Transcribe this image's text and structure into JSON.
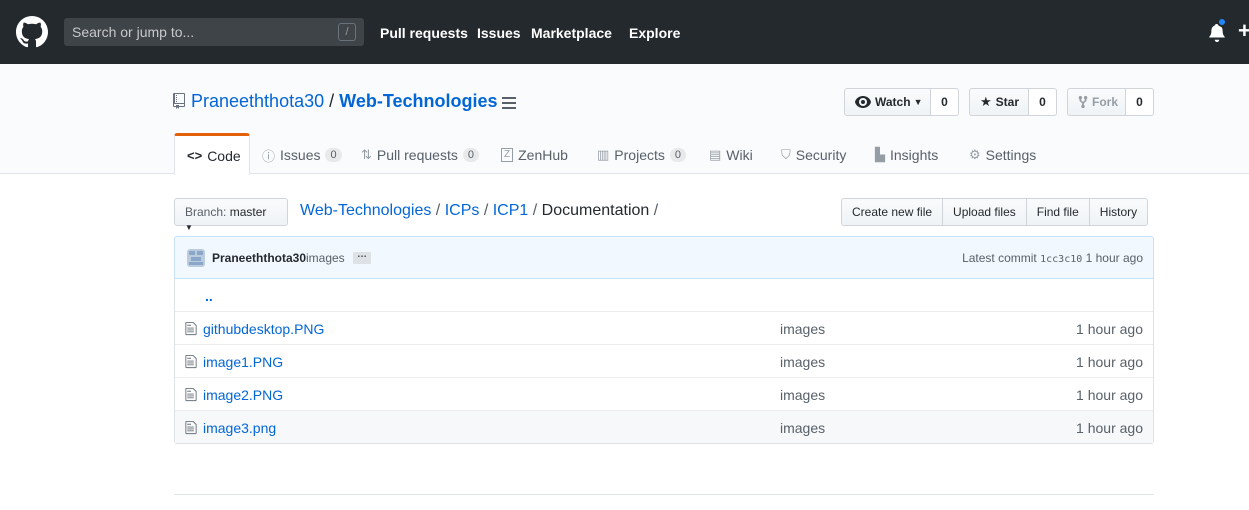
{
  "header": {
    "search_placeholder": "Search or jump to...",
    "slash_key": "/",
    "nav": [
      "Pull requests",
      "Issues",
      "Marketplace",
      "Explore"
    ],
    "plus": "+"
  },
  "repo": {
    "owner": "Praneeththota30",
    "separator": "/",
    "name": "Web-Technologies",
    "watch_label": "Watch",
    "watch_count": "0",
    "star_label": "Star",
    "star_count": "0",
    "fork_label": "Fork",
    "fork_count": "0"
  },
  "tabs": [
    {
      "label": "Code",
      "icon": "code-icon"
    },
    {
      "label": "Issues",
      "count": "0",
      "icon": "issue-icon"
    },
    {
      "label": "Pull requests",
      "count": "0",
      "icon": "pull-request-icon"
    },
    {
      "label": "ZenHub",
      "icon": "zenhub-icon"
    },
    {
      "label": "Projects",
      "count": "0",
      "icon": "project-icon"
    },
    {
      "label": "Wiki",
      "icon": "book-icon"
    },
    {
      "label": "Security",
      "icon": "shield-icon"
    },
    {
      "label": "Insights",
      "icon": "graph-icon"
    },
    {
      "label": "Settings",
      "icon": "gear-icon"
    }
  ],
  "filenav": {
    "branch_prefix": "Branch:",
    "branch": "master",
    "crumbs": [
      "Web-Technologies",
      "ICPs",
      "ICP1"
    ],
    "current": "Documentation",
    "sep": "/",
    "buttons": [
      "Create new file",
      "Upload files",
      "Find file",
      "History"
    ]
  },
  "commit": {
    "author": "Praneeththota30",
    "message": "images",
    "ellipsis": "…",
    "latest_label": "Latest commit",
    "sha": "1cc3c10",
    "age": "1 hour ago"
  },
  "files": {
    "up": "..",
    "rows": [
      {
        "name": "githubdesktop.PNG",
        "message": "images",
        "age": "1 hour ago"
      },
      {
        "name": "image1.PNG",
        "message": "images",
        "age": "1 hour ago"
      },
      {
        "name": "image2.PNG",
        "message": "images",
        "age": "1 hour ago"
      },
      {
        "name": "image3.png",
        "message": "images",
        "age": "1 hour ago"
      }
    ]
  },
  "colors": {
    "header_bg": "#24292e",
    "link": "#0366d6",
    "tab_accent": "#e36209",
    "commit_bg": "#f1f8ff"
  }
}
